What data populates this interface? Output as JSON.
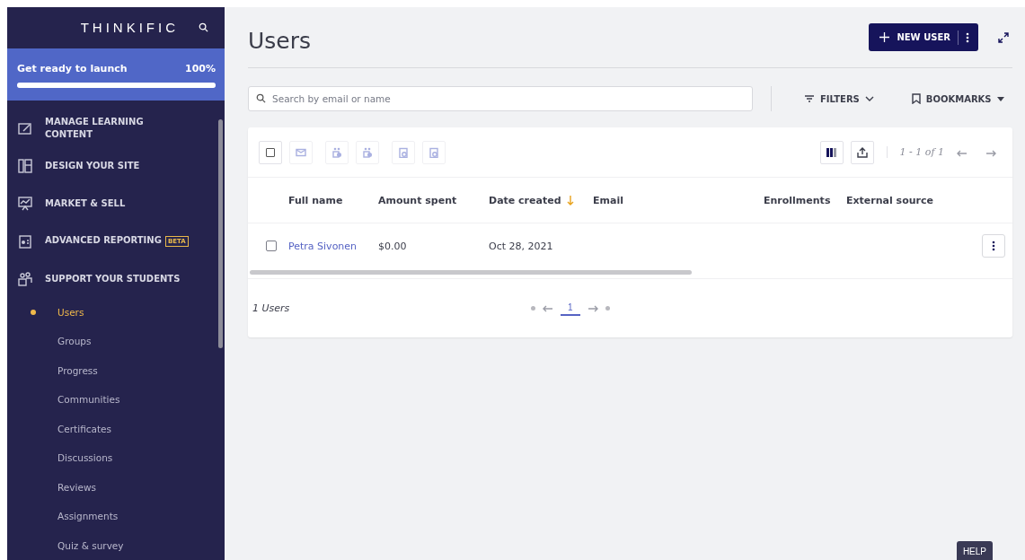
{
  "sidebar": {
    "logo": "THINKIFIC",
    "launch": {
      "label": "Get ready to launch",
      "percent": "100%",
      "level": 1
    },
    "sections": [
      {
        "kind": "content",
        "label": "MANAGE LEARNING CONTENT"
      },
      {
        "kind": "design",
        "label": "DESIGN YOUR SITE"
      },
      {
        "kind": "market",
        "label": "MARKET & SELL"
      },
      {
        "kind": "reporting",
        "label": "ADVANCED REPORTING",
        "badge": "BETA"
      },
      {
        "kind": "students",
        "label": "SUPPORT YOUR STUDENTS",
        "children": [
          {
            "label": "Users",
            "selected": true
          },
          {
            "label": "Groups",
            "selected": false
          },
          {
            "label": "Progress",
            "selected": false
          },
          {
            "label": "Communities",
            "selected": false
          },
          {
            "label": "Certificates",
            "selected": false
          },
          {
            "label": "Discussions",
            "selected": false
          },
          {
            "label": "Reviews",
            "selected": false
          },
          {
            "label": "Assignments",
            "selected": false
          },
          {
            "label": "Quiz & survey",
            "selected": false
          }
        ]
      }
    ]
  },
  "page": {
    "title": "Users",
    "new_button": "NEW USER"
  },
  "search": {
    "placeholder": "Search by email or name"
  },
  "filters": "FILTERS",
  "bookmarks": "BOOKMARKS",
  "toolbar": {
    "select_all": {
      "checked": false
    },
    "actions": [
      {
        "kind": "email",
        "disabled": true
      },
      {
        "kind": "group-add",
        "disabled": true
      },
      {
        "kind": "group-remove",
        "disabled": true
      },
      {
        "kind": "course-add",
        "disabled": true
      },
      {
        "kind": "course-remove",
        "disabled": true
      }
    ],
    "range": "1 - 1 of 1"
  },
  "table": {
    "columns": [
      {
        "label": "Full name",
        "sorted": false
      },
      {
        "label": "Amount spent",
        "sorted": false
      },
      {
        "label": "Date created",
        "sorted": true
      },
      {
        "label": "Email",
        "sorted": false
      },
      {
        "label": "Enrollments",
        "sorted": false
      },
      {
        "label": "External source",
        "sorted": false
      }
    ],
    "rows": [
      {
        "checked": false,
        "cells": [
          "Petra Sivonen",
          "$0.00",
          "Oct 28, 2021"
        ]
      }
    ]
  },
  "footer": {
    "count": "1 Users",
    "pages": [
      {
        "label": "1",
        "selected": true
      }
    ]
  },
  "help": "HELP"
}
